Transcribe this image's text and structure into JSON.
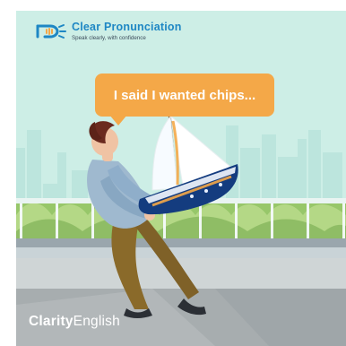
{
  "brand": {
    "title": "Clear Pronunciation",
    "subtitle": "Speak clearly, with confidence"
  },
  "bubble": {
    "text": "I said I wanted chips..."
  },
  "footer": {
    "brand_bold": "Clarity",
    "brand_light": "English"
  },
  "colors": {
    "sky": "#cdeee6",
    "accent_orange": "#f4a848",
    "brand_blue": "#1e87c4"
  }
}
